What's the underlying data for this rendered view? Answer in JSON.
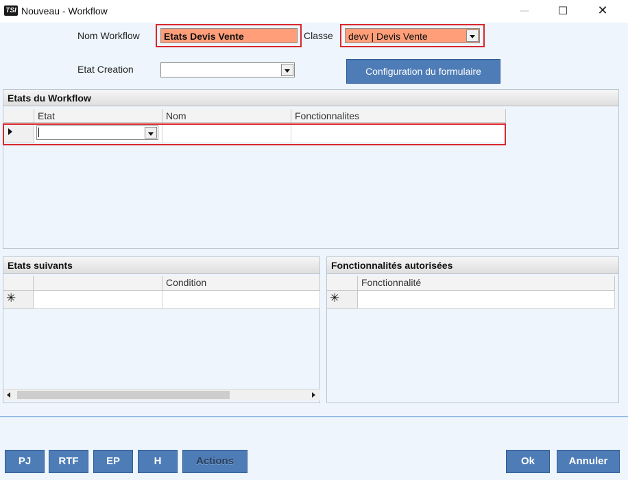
{
  "window": {
    "icon_text": "TSI",
    "title": "Nouveau - Workflow",
    "minimize_glyph": "—",
    "maximize_glyph": "☐",
    "close_glyph": "✕"
  },
  "form": {
    "nom_workflow_label": "Nom Workflow",
    "nom_workflow_value": "Etats Devis Vente",
    "classe_label": "Classe",
    "classe_value": "devv | Devis Vente",
    "etat_creation_label": "Etat Creation",
    "etat_creation_value": "",
    "config_button": "Configuration du formulaire"
  },
  "etats_workflow": {
    "title": "Etats du Workflow",
    "columns": [
      "Etat",
      "Nom",
      "Fonctionnalites"
    ],
    "row": {
      "etat": "",
      "nom": "",
      "fonctionnalites": ""
    }
  },
  "etats_suivants": {
    "title": "Etats suivants",
    "columns": [
      "",
      "Condition"
    ],
    "new_row_glyph": "✳"
  },
  "fonctionnalites": {
    "title": "Fonctionnalités autorisées",
    "columns": [
      "Fonctionnalité"
    ],
    "new_row_glyph": "✳"
  },
  "bottom_buttons": {
    "pj": "PJ",
    "rtf": "RTF",
    "ep": "EP",
    "h": "H",
    "actions": "Actions",
    "ok": "Ok",
    "annuler": "Annuler"
  },
  "colors": {
    "accent_button": "#4e7cb6",
    "highlight_field": "#ff9e78",
    "annotation_red": "#d9262b"
  }
}
